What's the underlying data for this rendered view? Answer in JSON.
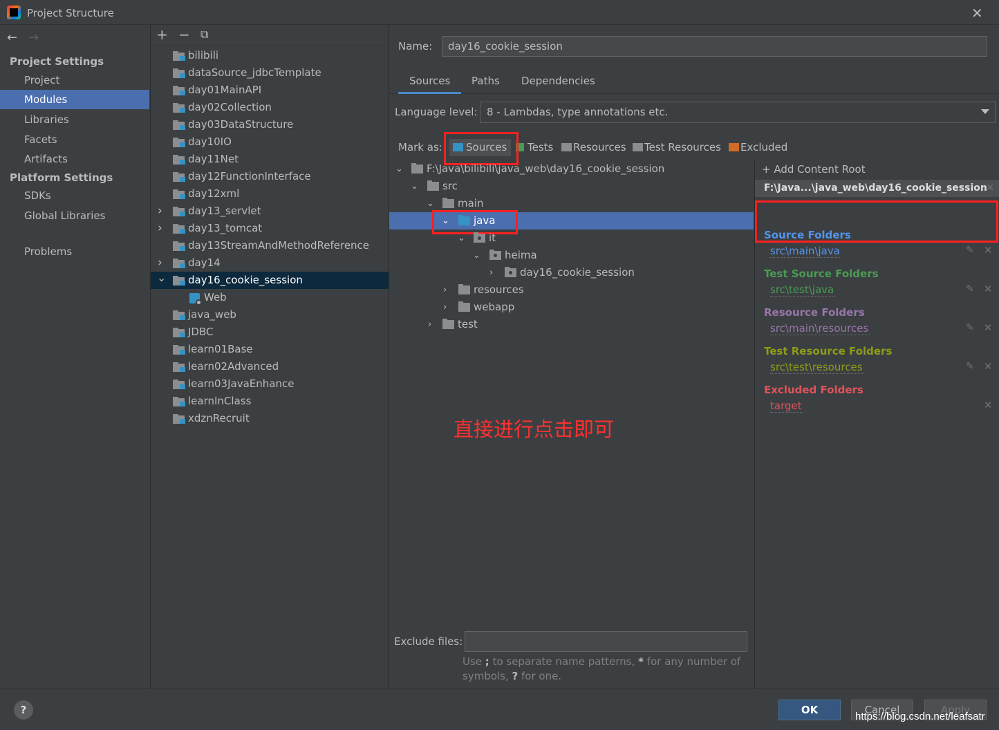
{
  "window": {
    "title": "Project Structure"
  },
  "sidebar": {
    "project_settings_title": "Project Settings",
    "project_items": [
      "Project",
      "Modules",
      "Libraries",
      "Facets",
      "Artifacts"
    ],
    "platform_settings_title": "Platform Settings",
    "platform_items": [
      "SDKs",
      "Global Libraries"
    ],
    "problems": "Problems",
    "selected": "Modules"
  },
  "modules": {
    "items": [
      "bilibili",
      "dataSource_jdbcTemplate",
      "day01MainAPI",
      "day02Collection",
      "day03DataStructure",
      "day10IO",
      "day11Net",
      "day12FunctionInterface",
      "day12xml",
      "day13_servlet",
      "day13_tomcat",
      "day13StreamAndMethodReference",
      "day14",
      "day16_cookie_session",
      "Web",
      "java_web",
      "JDBC",
      "learn01Base",
      "learn02Advanced",
      "learn03JavaEnhance",
      "learnInClass",
      "xdznRecruit"
    ],
    "selected": "day16_cookie_session"
  },
  "content": {
    "name_label": "Name:",
    "name_value": "day16_cookie_session",
    "tabs": [
      "Sources",
      "Paths",
      "Dependencies"
    ],
    "active_tab": "Sources",
    "language_label": "Language level:",
    "language_value": "8 - Lambdas, type annotations etc.",
    "mark_as_label": "Mark as:",
    "mark_buttons": [
      "Sources",
      "Tests",
      "Resources",
      "Test Resources",
      "Excluded"
    ],
    "tree": [
      "F:\\Java\\bilibili\\java_web\\day16_cookie_session",
      "src",
      "main",
      "java",
      "it",
      "heima",
      "day16_cookie_session",
      "resources",
      "webapp",
      "test"
    ],
    "annotation": "直接进行点击即可",
    "exclude_label": "Exclude files:",
    "exclude_hint_1": "Use ",
    "exclude_hint_semicolon": ";",
    "exclude_hint_2": " to separate name patterns, ",
    "exclude_hint_star": "*",
    "exclude_hint_3": " for any number of symbols, ",
    "exclude_hint_q": "?",
    "exclude_hint_4": " for one."
  },
  "content_roots": {
    "add_label": "Add Content Root",
    "root_path": "F:\\Java...\\java_web\\day16_cookie_session",
    "groups": [
      {
        "title": "Source Folders",
        "path": "src\\main\\java",
        "color": "#5394ec"
      },
      {
        "title": "Test Source Folders",
        "path": "src\\test\\java",
        "color": "#499c54"
      },
      {
        "title": "Resource Folders",
        "path": "src\\main\\resources",
        "color": "#9876aa"
      },
      {
        "title": "Test Resource Folders",
        "path": "src\\test\\resources",
        "color": "#8c9c17"
      },
      {
        "title": "Excluded Folders",
        "path": "target",
        "color": "#e0535a"
      }
    ]
  },
  "buttons": {
    "ok": "OK",
    "cancel": "Cancel",
    "apply": "Apply",
    "help": "?"
  },
  "watermark": "https://blog.csdn.net/leafsatr"
}
